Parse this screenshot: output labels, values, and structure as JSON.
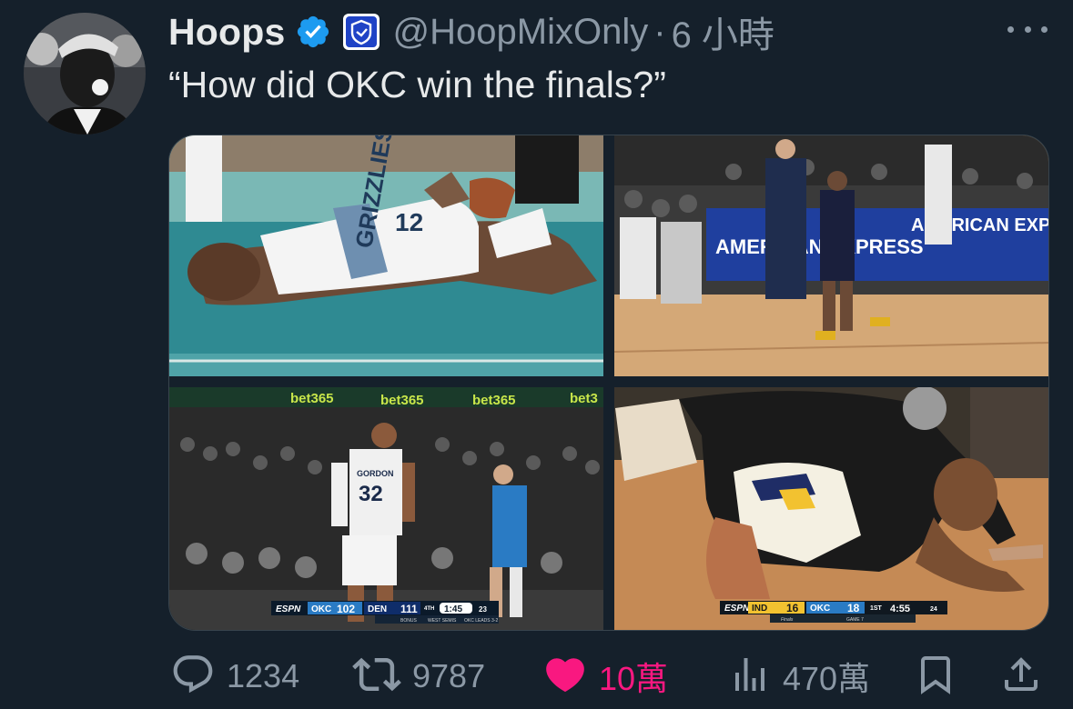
{
  "author": {
    "display_name": "Hoops",
    "handle": "@HoopMixOnly",
    "separator": "·",
    "time": "6 小時"
  },
  "tweet": {
    "text": "“How did OKC win the finals?”"
  },
  "media": {
    "image_1": {
      "jersey_text": "GRIZZLIES",
      "jersey_number": "12"
    },
    "image_2": {
      "board_text_1": "AMERICAN EXPRESS",
      "board_text_2": "AMERICAN EXP"
    },
    "image_3": {
      "banner": [
        "bet365",
        "bet365",
        "bet365",
        "bet3"
      ],
      "player_number": "32",
      "player_name": "GORDON",
      "score": {
        "network": "ESPN",
        "team1": "OKC",
        "score1": "102",
        "team2": "DEN",
        "score2": "111",
        "period": "4TH",
        "clock": "1:45",
        "shot_clock": "23",
        "sub_left": "BONUS",
        "sub_mid": "WEST SEMIS",
        "sub_right": "OKC LEADS 3-2"
      }
    },
    "image_4": {
      "score": {
        "network": "ESPN",
        "team1": "IND",
        "score1": "16",
        "team2": "OKC",
        "score2": "18",
        "period": "1ST",
        "clock": "4:55",
        "shot_clock": "24",
        "sub_left": "Finals",
        "sub_right": "GAME 7"
      }
    }
  },
  "actions": {
    "reply_count": "1234",
    "repost_count": "9787",
    "like_count": "10萬",
    "views_count": "470萬"
  },
  "colors": {
    "background": "#15202b",
    "text_primary": "#e7e9ea",
    "text_secondary": "#8b98a5",
    "verified_blue": "#1d9bf0",
    "like_pink": "#f91880"
  },
  "icons": {
    "verified": "verified-badge-icon",
    "affiliate": "affiliate-badge-icon",
    "more": "more-icon",
    "reply": "reply-icon",
    "repost": "repost-icon",
    "like": "heart-icon",
    "views": "views-icon",
    "bookmark": "bookmark-icon",
    "share": "share-icon"
  }
}
